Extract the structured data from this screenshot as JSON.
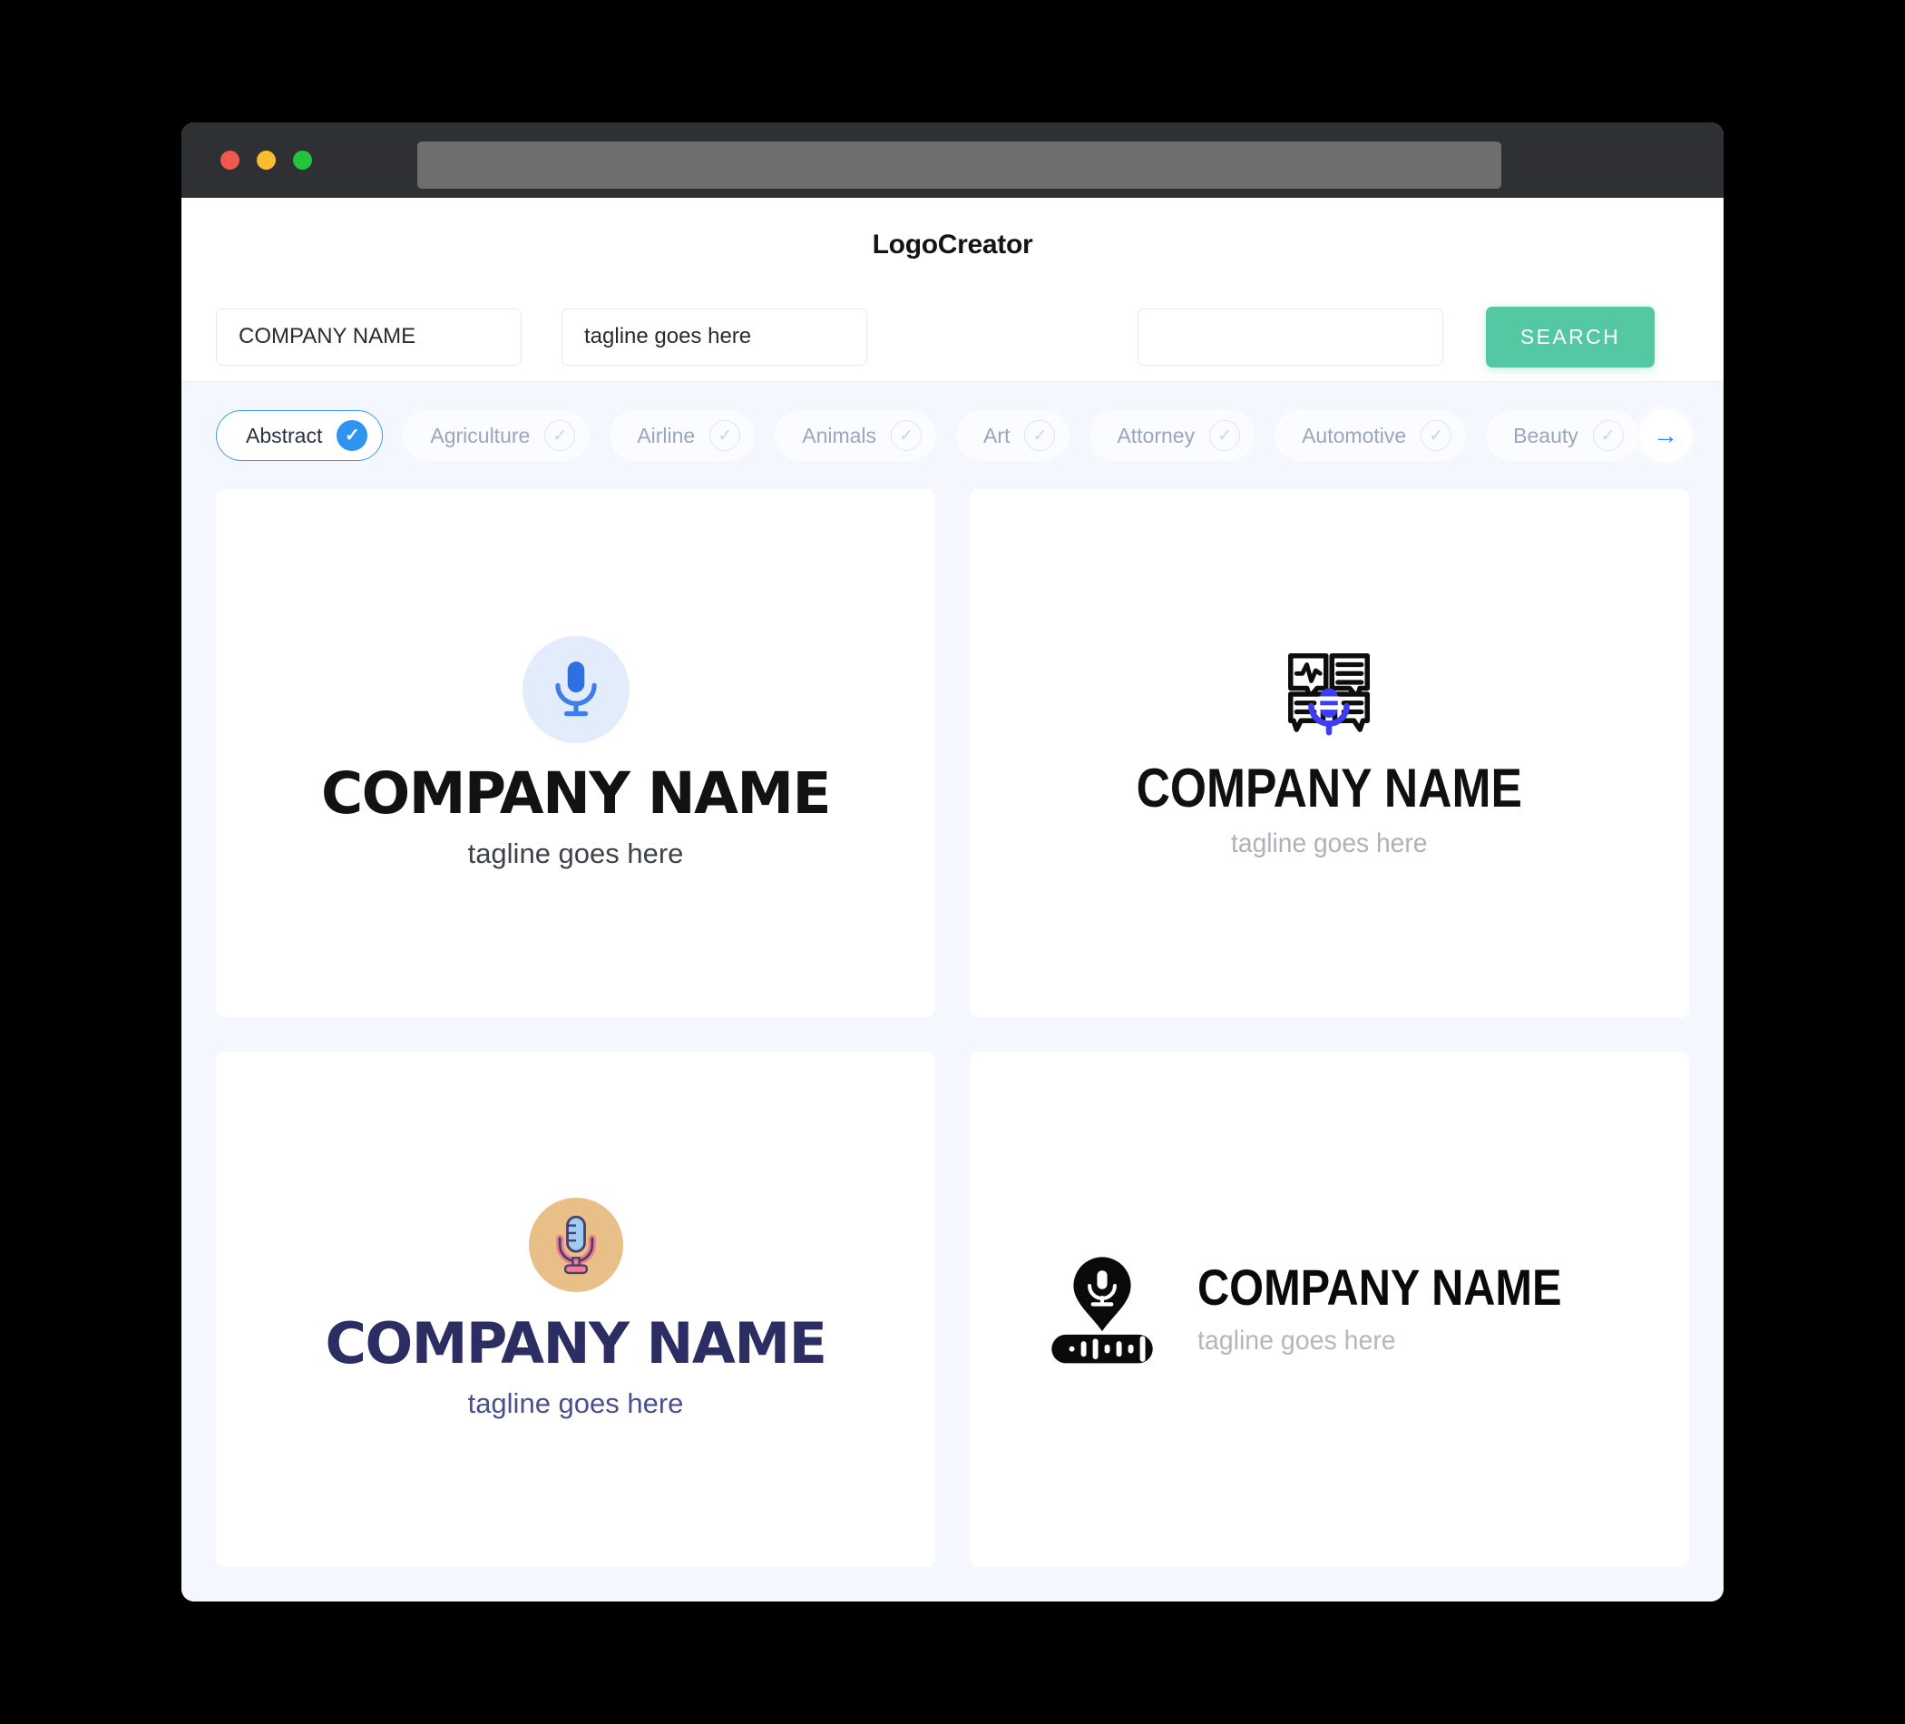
{
  "window": {
    "traffic_lights": [
      "close",
      "minimize",
      "maximize"
    ],
    "url_value": ""
  },
  "header": {
    "title": "LogoCreator"
  },
  "search": {
    "company_value": "COMPANY NAME",
    "tagline_value": "tagline goes here",
    "extra_value": "",
    "extra_placeholder": "",
    "button_label": "SEARCH"
  },
  "categories": {
    "next_arrow": "→",
    "items": [
      {
        "label": "Abstract",
        "selected": true
      },
      {
        "label": "Agriculture",
        "selected": false
      },
      {
        "label": "Airline",
        "selected": false
      },
      {
        "label": "Animals",
        "selected": false
      },
      {
        "label": "Art",
        "selected": false
      },
      {
        "label": "Attorney",
        "selected": false
      },
      {
        "label": "Automotive",
        "selected": false
      },
      {
        "label": "Beauty",
        "selected": false
      }
    ]
  },
  "results": [
    {
      "icon": "microphone-in-circle-icon",
      "name": "COMPANY NAME",
      "tagline": "tagline goes here",
      "name_color": "#121212",
      "tagline_color": "#3f4248",
      "accent_color": "#2f6fe0"
    },
    {
      "icon": "podcast-speech-bubbles-microphone-icon",
      "name": "COMPANY NAME",
      "tagline": "tagline goes here",
      "name_color": "#101010",
      "tagline_color": "#aeb2b8",
      "accent_color": "#3d3df5"
    },
    {
      "icon": "retro-microphone-in-circle-icon",
      "name": "COMPANY NAME",
      "tagline": "tagline goes here",
      "name_color": "#2b2d63",
      "tagline_color": "#4b4f8d",
      "accent_color": "#e8bf86"
    },
    {
      "icon": "microphone-pin-with-waveform-icon",
      "name": "COMPANY NAME",
      "tagline": "tagline goes here",
      "name_color": "#0a0a0a",
      "tagline_color": "#b3b7bd",
      "accent_color": "#000000"
    }
  ],
  "colors": {
    "search_button": "#53c8a2",
    "chip_active_border": "#3d9bf5",
    "chip_active_tick": "#2f93f0",
    "page_background": "#f4f7fe",
    "titlebar": "#2f3033"
  }
}
